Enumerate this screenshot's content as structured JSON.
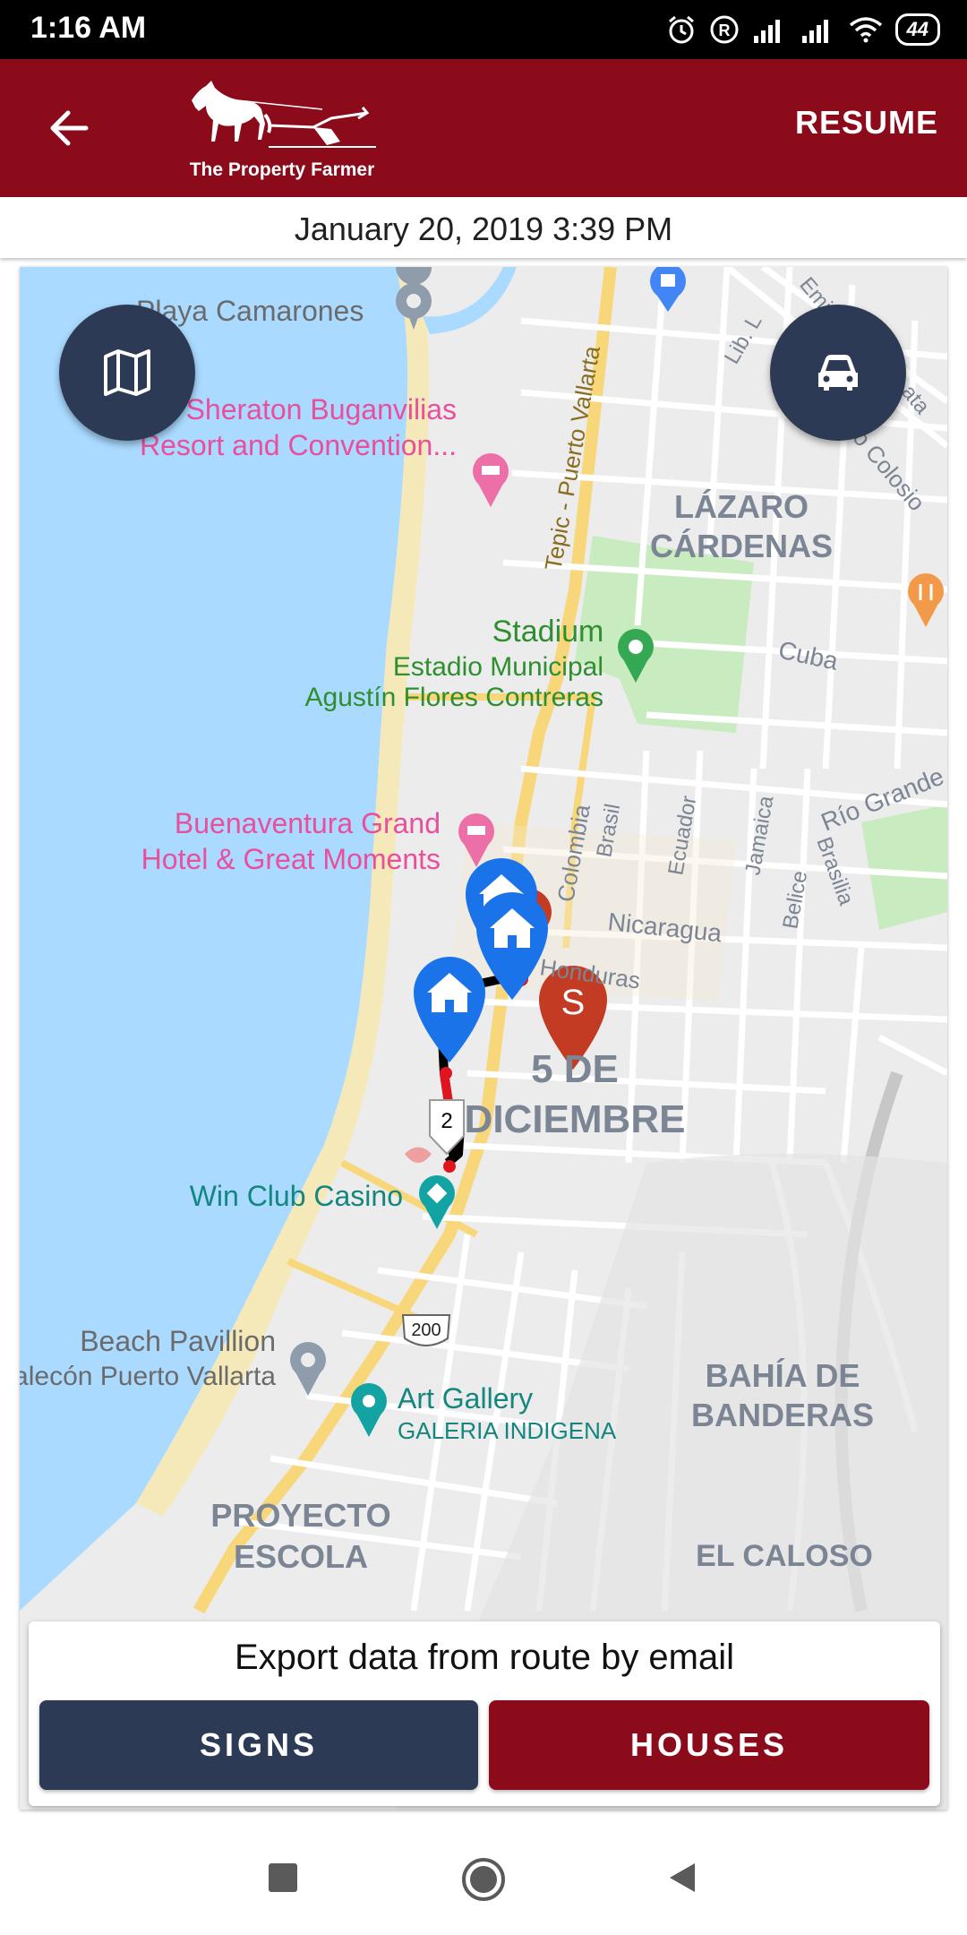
{
  "status_bar": {
    "time": "1:16 AM",
    "battery": "44",
    "icons": [
      "alarm-icon",
      "registered-icon",
      "signal-icon",
      "signal-icon",
      "wifi-icon",
      "battery-icon"
    ]
  },
  "app_bar": {
    "back_icon": "arrow-left-icon",
    "logo_text": "The Property Farmer",
    "resume_label": "RESUME",
    "color": "#8b0b1b"
  },
  "date_label": "January 20, 2019 3:39 PM",
  "map": {
    "labels": {
      "playa": "Playa Camarones",
      "sheraton1": "Sheraton Buganvilias",
      "sheraton2": "Resort and Convention...",
      "lazaro1": "LÁZARO",
      "lazaro2": "CÁRDENAS",
      "stadium": "Stadium",
      "estadio1": "Estadio Municipal",
      "estadio2": "Agustín Flores Contreras",
      "cuba": "Cuba",
      "rio": "Río Grande",
      "buena1": "Buenaventura Grand",
      "buena2": "Hotel & Great Moments",
      "colombia": "Colombia",
      "brasil": "Brasil",
      "ecuador": "Ecuador",
      "jamaica": "Jamaica",
      "belice": "Belice",
      "brasilia": "Brasilia",
      "nicaragua": "Nicaragua",
      "honduras": "Honduras",
      "tepic": "Tepic - Puerto Vallarta",
      "lib": "Lib. L",
      "colosio": "do Colosio",
      "emilio": "Emil",
      "ata": "ata",
      "dic1": "5 DE",
      "dic2": "DICIEMBRE",
      "win": "Win Club Casino",
      "beach1": "Beach Pavillion",
      "beach2": "alecón Puerto Vallarta",
      "art1": "Art Gallery",
      "art2": "GALERIA INDIGENA",
      "bahia1": "BAHÍA DE",
      "bahia2": "BANDERAS",
      "proy1": "PROYECTO",
      "proy2": "ESCOLA",
      "caloso": "EL CALOSO",
      "route_badge": "2",
      "start_marker": "S",
      "highway": "200"
    },
    "left_fab_icon": "map-icon",
    "right_fab_icon": "car-icon",
    "colors": {
      "water": "#aadaff",
      "park": "#c8ecbf",
      "marker_blue": "#1a73e8",
      "marker_red": "#c23b22",
      "route": "#000000"
    }
  },
  "export": {
    "title": "Export data from route by email",
    "signs_label": "SIGNS",
    "houses_label": "HOUSES"
  },
  "nav_bar": {
    "icons": [
      "recent-apps-icon",
      "home-icon",
      "back-icon"
    ]
  }
}
